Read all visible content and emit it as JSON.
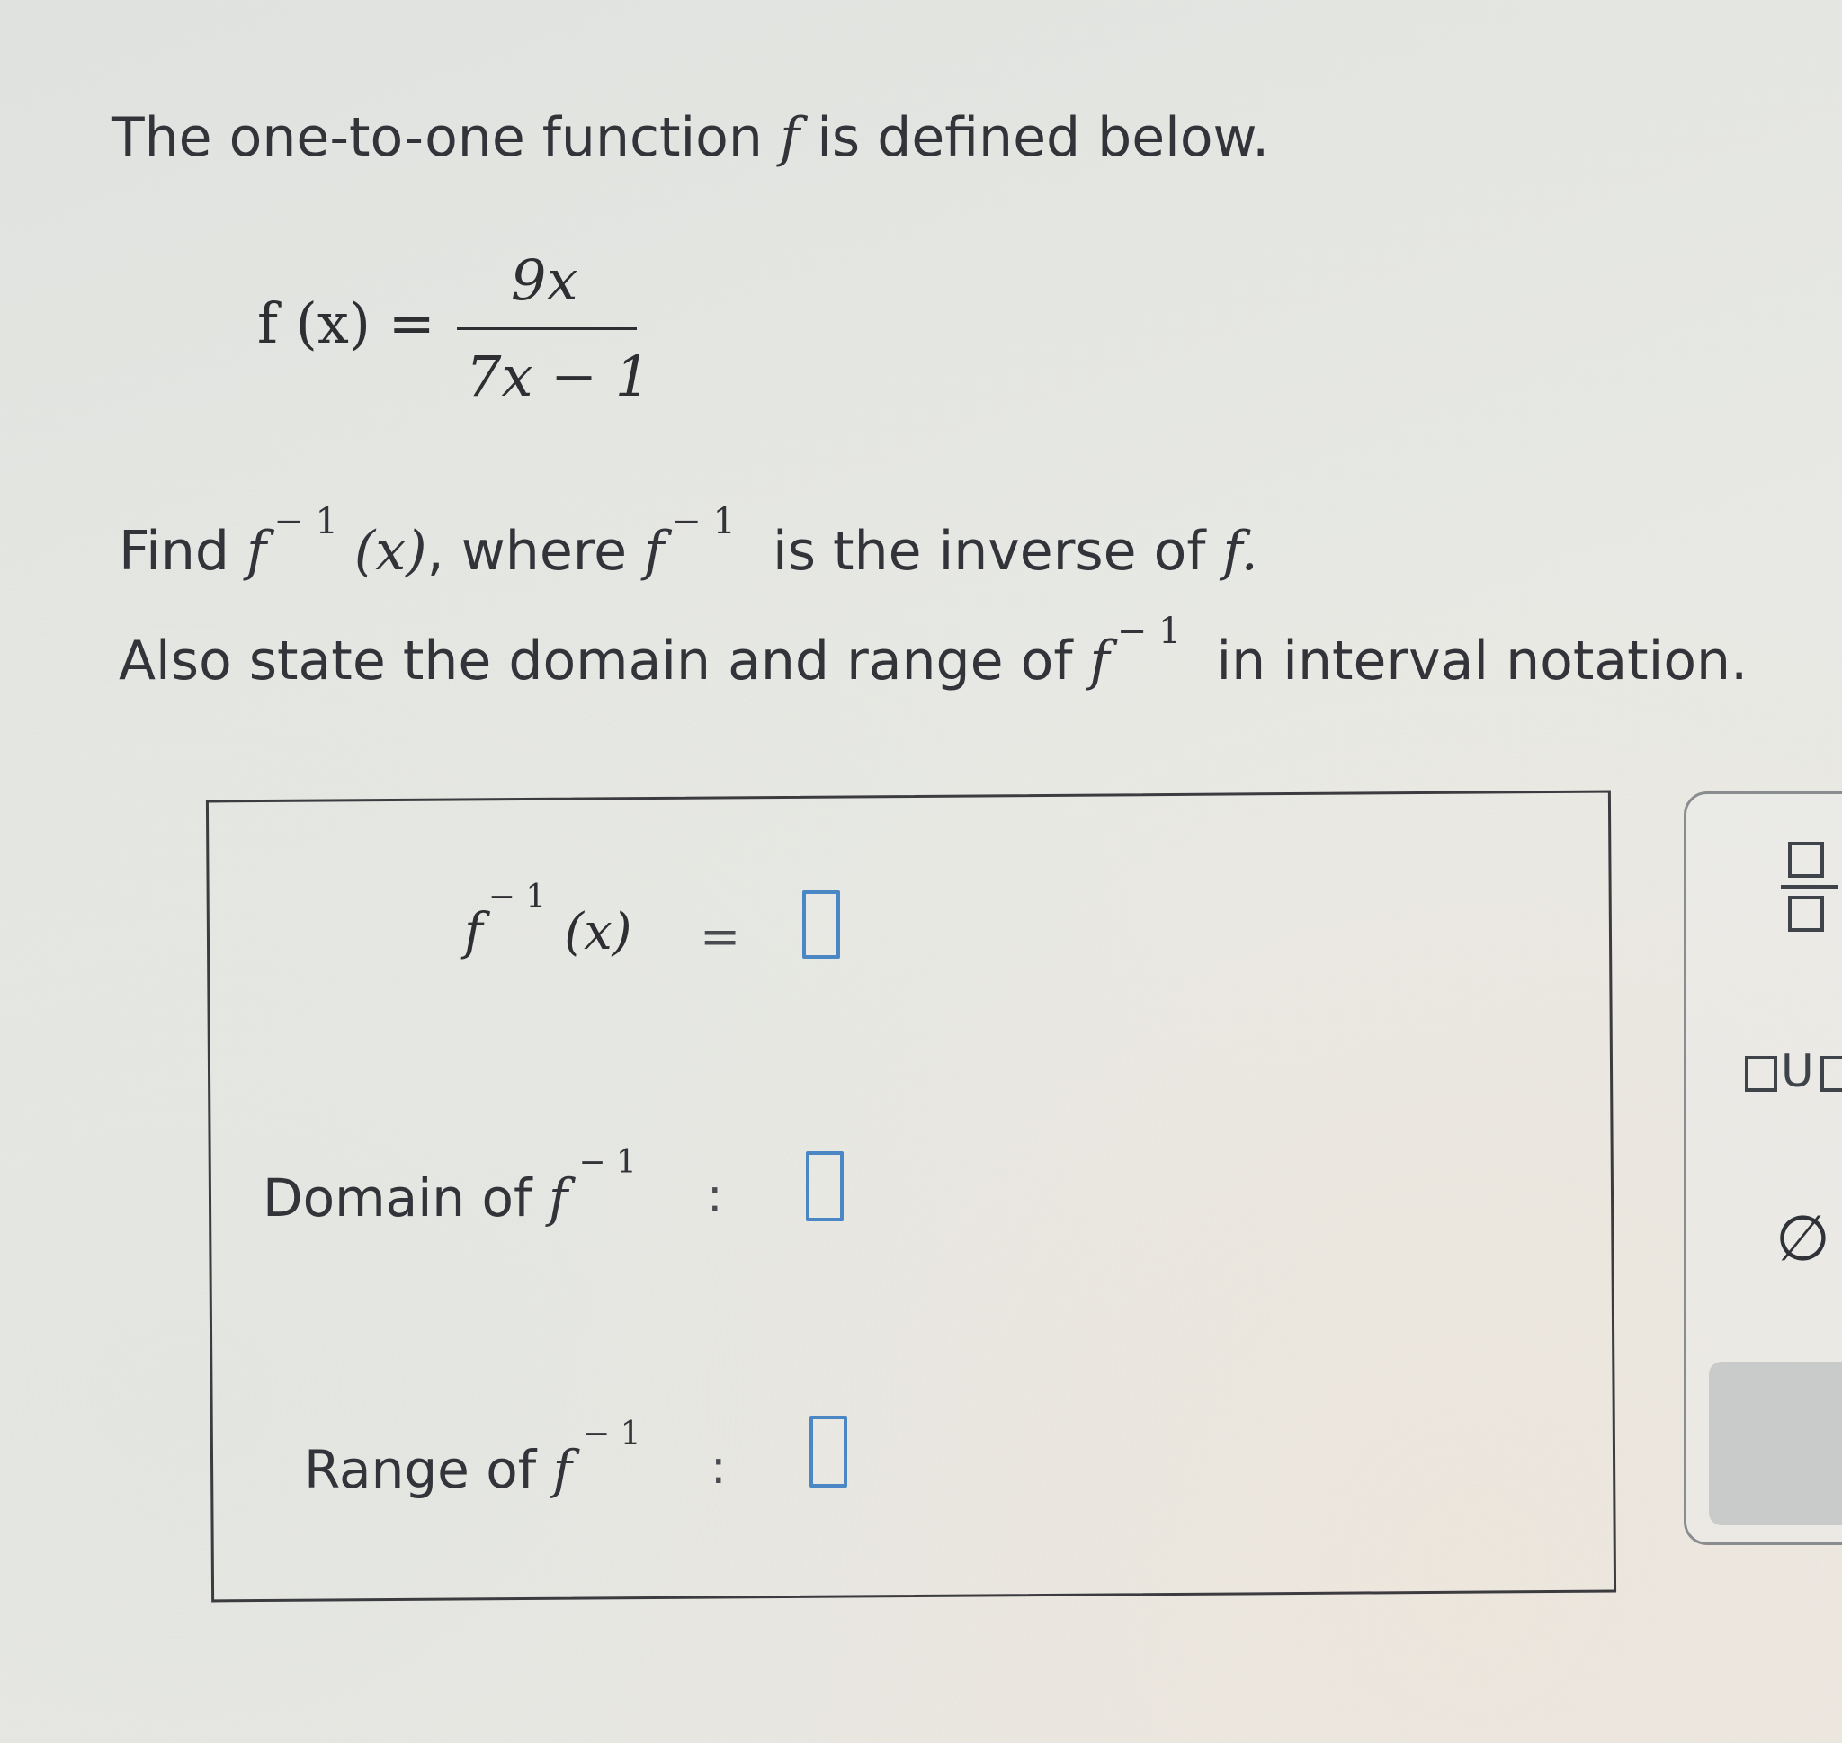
{
  "problem": {
    "intro_before": "The one-to-one function ",
    "intro_var": "f",
    "intro_after": " is defined below.",
    "function_lhs": "f (x) =",
    "numerator": "9x",
    "denominator": "7x − 1",
    "find_word": "Find ",
    "find_f": "f",
    "find_sup": "− 1",
    "find_x": "(x)",
    "find_where": ", where ",
    "where_f": "f",
    "where_sup": "− 1",
    "inverse_text": " is the inverse of ",
    "inverse_f": "f.",
    "also_text": "Also state the domain and range of ",
    "also_f": "f",
    "also_sup": "− 1",
    "interval_text": " in interval notation."
  },
  "answer": {
    "inverse_f": "f",
    "inverse_sup": "− 1",
    "inverse_x": "(x)",
    "equals": "=",
    "domain_label": "Domain of ",
    "domain_f": "f",
    "domain_sup": "− 1",
    "domain_colon": ":",
    "range_label": "Range of ",
    "range_f": "f",
    "range_sup": "− 1",
    "range_colon": ":"
  },
  "palette": {
    "union_text": "U",
    "empty_set": "∅"
  },
  "icons": {
    "fraction": "fraction-icon",
    "union": "union-icon",
    "empty_set": "empty-set-icon"
  },
  "colors": {
    "input_border": "#4a87c4",
    "text": "#33333a"
  }
}
